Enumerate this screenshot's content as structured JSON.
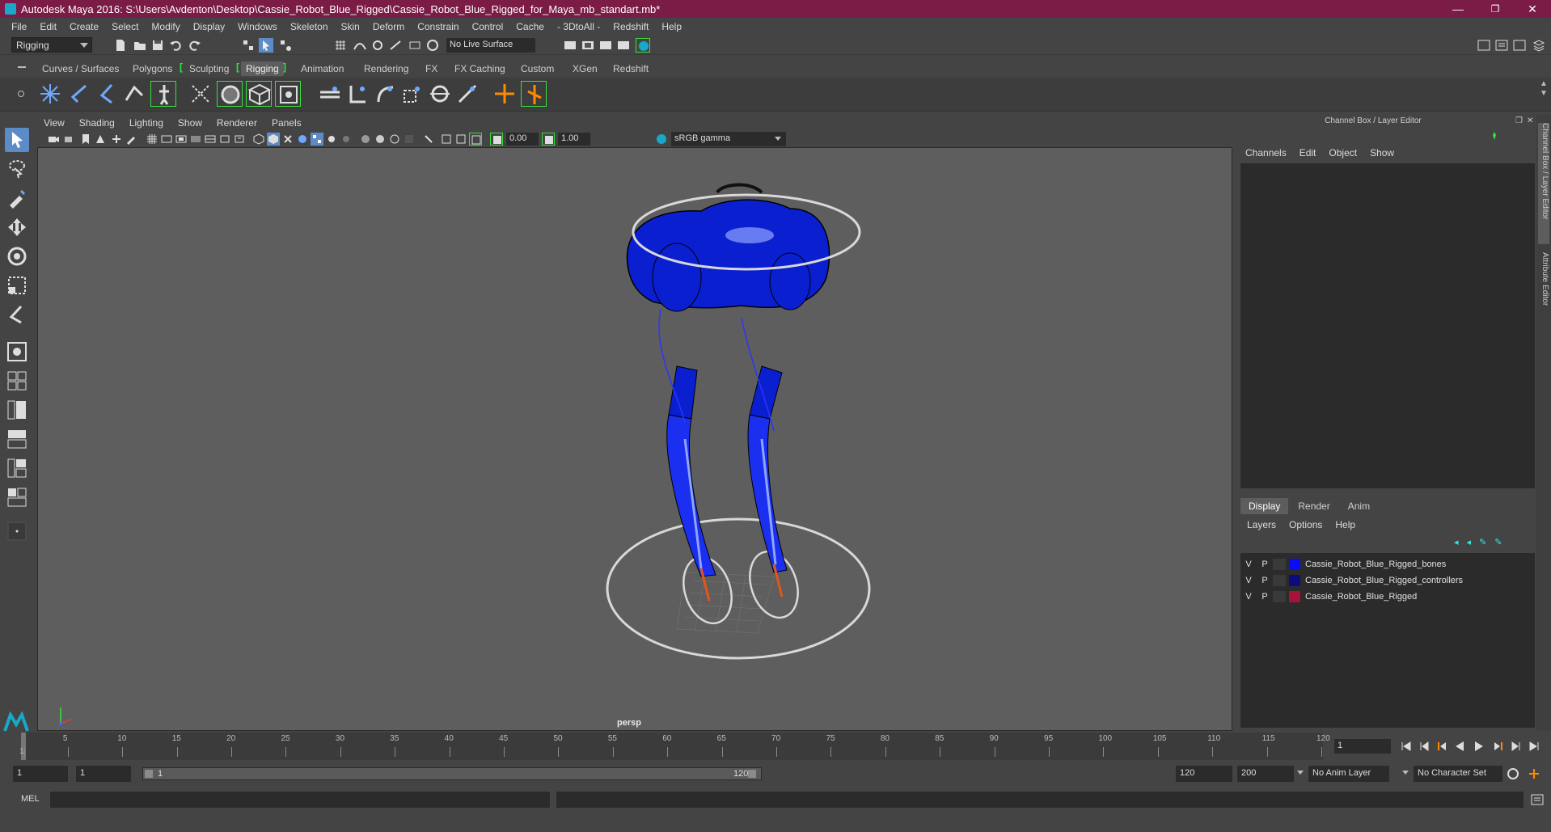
{
  "window": {
    "title": "Autodesk Maya 2016: S:\\Users\\Avdenton\\Desktop\\Cassie_Robot_Blue_Rigged\\Cassie_Robot_Blue_Rigged_for_Maya_mb_standart.mb*",
    "minimize": "—",
    "maximize": "❐",
    "close": "✕"
  },
  "menubar": [
    "File",
    "Edit",
    "Create",
    "Select",
    "Modify",
    "Display",
    "Windows",
    "Skeleton",
    "Skin",
    "Deform",
    "Constrain",
    "Control",
    "Cache",
    "- 3DtoAll -",
    "Redshift",
    "Help"
  ],
  "statusline": {
    "mode": "Rigging",
    "live_surface": "No Live Surface"
  },
  "shelf_tabs": [
    "Curves / Surfaces",
    "Polygons",
    "Sculpting",
    "Rigging",
    "Animation",
    "Rendering",
    "FX",
    "FX Caching",
    "Custom",
    "XGen",
    "Redshift"
  ],
  "shelf_active": "Rigging",
  "panel_menu": [
    "View",
    "Shading",
    "Lighting",
    "Show",
    "Renderer",
    "Panels"
  ],
  "panel_tools": {
    "exposure": "0.00",
    "gamma": "1.00",
    "color_space": "sRGB gamma"
  },
  "viewport": {
    "camera_label": "persp"
  },
  "channel_box": {
    "title": "Channel Box / Layer Editor",
    "menu": [
      "Channels",
      "Edit",
      "Object",
      "Show"
    ]
  },
  "layer_editor": {
    "tabs": [
      "Display",
      "Render",
      "Anim"
    ],
    "active_tab": "Display",
    "menu": [
      "Layers",
      "Options",
      "Help"
    ],
    "layers": [
      {
        "v": "V",
        "p": "P",
        "color": "#0a0aff",
        "name": "Cassie_Robot_Blue_Rigged_bones"
      },
      {
        "v": "V",
        "p": "P",
        "color": "#0c0c80",
        "name": "Cassie_Robot_Blue_Rigged_controllers"
      },
      {
        "v": "V",
        "p": "P",
        "color": "#a5123a",
        "name": "Cassie_Robot_Blue_Rigged"
      }
    ]
  },
  "side_tabs": [
    "Channel Box / Layer Editor",
    "Attribute Editor"
  ],
  "timeslider": {
    "ticks": [
      "1",
      "5",
      "10",
      "15",
      "20",
      "25",
      "30",
      "35",
      "40",
      "45",
      "50",
      "55",
      "60",
      "65",
      "70",
      "75",
      "80",
      "85",
      "90",
      "95",
      "100",
      "105",
      "110",
      "115",
      "120"
    ],
    "current_frame": "1"
  },
  "range": {
    "start": "1",
    "playback_start": "1",
    "bar_start": "1",
    "bar_end": "120",
    "playback_end": "120",
    "end": "200",
    "anim_layer": "No Anim Layer",
    "character_set": "No Character Set"
  },
  "cmdline": {
    "label": "MEL"
  },
  "colors": {
    "title_bar": "#7a1c45",
    "accent_green": "#36e33b",
    "robot_blue": "#0a1fd0"
  }
}
